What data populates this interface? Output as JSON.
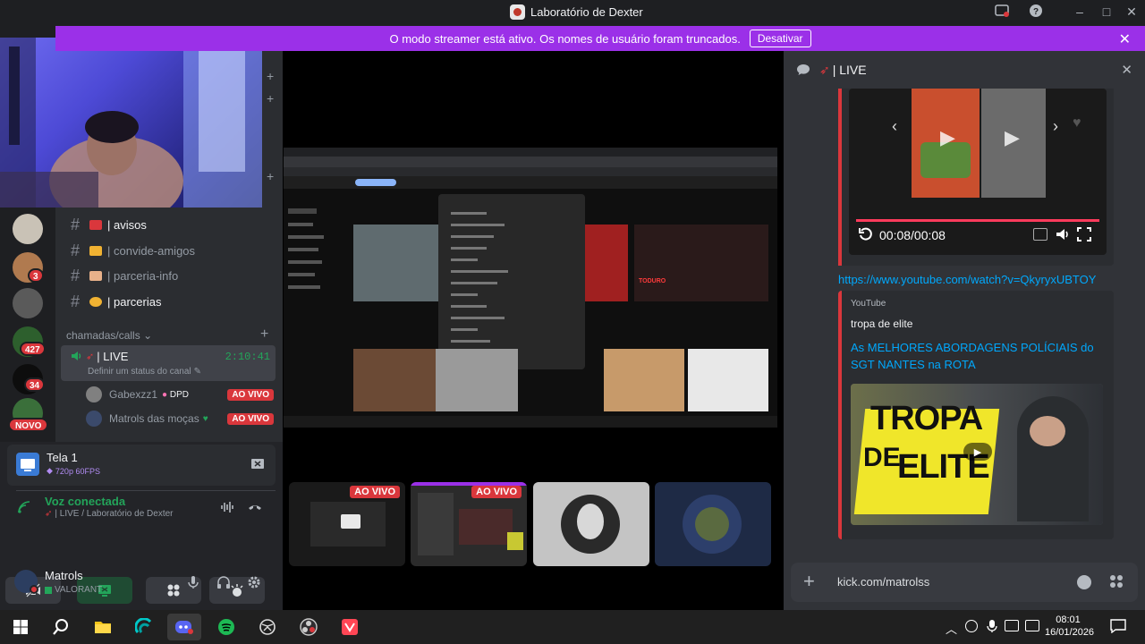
{
  "titlebar": {
    "title": "Laboratório de Dexter"
  },
  "banner": {
    "message": "O modo streamer está ativo. Os nomes de usuário foram truncados.",
    "button": "Desativar"
  },
  "rail": {
    "badges": [
      "3",
      "427",
      "34"
    ],
    "new_label": "NOVO"
  },
  "channels": [
    {
      "name": "| avisos",
      "bold": true,
      "color": "#da373c"
    },
    {
      "name": "| convide-amigos",
      "bold": false,
      "color": "#f0b232"
    },
    {
      "name": "| parceria-info",
      "bold": false,
      "color": "#e8b18a"
    },
    {
      "name": "| parcerias",
      "bold": true,
      "color": "#f0b232"
    }
  ],
  "voice_category": "chamadas/calls",
  "voice_channel": {
    "name": "| LIVE",
    "timer": "2:10:41",
    "status_hint": "Definir um status do canal"
  },
  "voice_users": [
    {
      "name": "Gabexzz1",
      "tag": "DPD",
      "live": "AO VIVO"
    },
    {
      "name": "Matrols das moças",
      "live": "AO VIVO"
    }
  ],
  "stream_panel": {
    "title": "Tela 1",
    "quality": "720p 60FPS"
  },
  "voice_panel": {
    "status": "Voz conectada",
    "location": "| LIVE / Laboratório de Dexter"
  },
  "user": {
    "name": "Matrols",
    "activity": "VALORANT"
  },
  "stage": {
    "tiles": [
      {
        "live": "AO VIVO"
      },
      {
        "live": "AO VIVO"
      },
      {
        "live": ""
      },
      {
        "live": ""
      }
    ]
  },
  "chat": {
    "header": "| LIVE",
    "video_time": "00:08/00:08",
    "link": "https://www.youtube.com/watch?v=QkyryxUBTOY",
    "embed_provider": "YouTube",
    "embed_author": "tropa de elite",
    "embed_title": "As MELHORES ABORDAGENS POLÍCIAIS do SGT NANTES na ROTA",
    "thumb_text_1": "TROPA",
    "thumb_text_2": "DE",
    "thumb_text_3": "ELITE",
    "input_value": "kick.com/matrolss"
  },
  "clock": {
    "time": "08:01",
    "date": "16/01/2026"
  },
  "colors": {
    "brand": "#5865f2",
    "streamer_banner": "#9b30e8",
    "live": "#da373c",
    "voice_green": "#23a55a"
  }
}
